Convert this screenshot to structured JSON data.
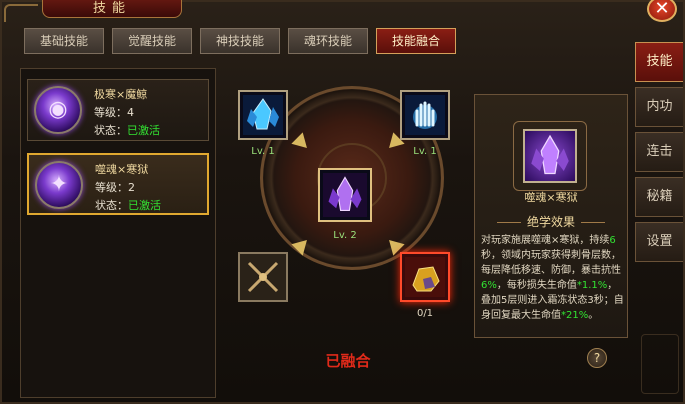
{
  "window": {
    "title": "技能",
    "close_icon": "close-icon"
  },
  "tabs": [
    {
      "label": "基础技能",
      "active": false
    },
    {
      "label": "觉醒技能",
      "active": false
    },
    {
      "label": "神技技能",
      "active": false
    },
    {
      "label": "魂环技能",
      "active": false
    },
    {
      "label": "技能融合",
      "active": true
    }
  ],
  "side_menu": [
    {
      "label": "技能",
      "active": true
    },
    {
      "label": "内功",
      "active": false
    },
    {
      "label": "连击",
      "active": false
    },
    {
      "label": "秘籍",
      "active": false
    },
    {
      "label": "设置",
      "active": false
    }
  ],
  "combos": [
    {
      "name": "极寒×魔鲸",
      "level_label": "等级：",
      "level": "4",
      "status_label": "状态：",
      "status": "已激活",
      "icon": "whale-orb-icon"
    },
    {
      "name": "噬魂×寒狱",
      "level_label": "等级：",
      "level": "2",
      "status_label": "状态：",
      "status": "已激活",
      "icon": "crystal-orb-icon"
    }
  ],
  "fusion": {
    "top_left": {
      "label": "Lv. 1",
      "icon": "ice-crystal-icon"
    },
    "top_right": {
      "label": "Lv. 1",
      "icon": "ice-hand-icon"
    },
    "center": {
      "label": "Lv. 2",
      "icon": "purple-crystal-icon"
    },
    "bottom_left": {
      "icon": "crossed-chains-icon"
    },
    "bottom_right": {
      "label": "0/1",
      "icon": "gold-ore-icon"
    },
    "status_text": "已融合"
  },
  "detail": {
    "combo_name": "噬魂×寒狱",
    "section_title": "绝学效果",
    "desc_1": "对玩家施展噬魂×寒狱，持续",
    "desc_g1": "6",
    "desc_2": "秒，领域内玩家获得刺骨层数，每层降低移速、防御，暴击抗性",
    "desc_g2": "6%",
    "desc_3": "，每秒损失生命值",
    "desc_g3": "*1.1%",
    "desc_4": "，叠加5层则进入霜冻状态3秒；自身回复最大生命值",
    "desc_g4": "*21%",
    "desc_5": "。"
  },
  "help": {
    "label": "?"
  }
}
